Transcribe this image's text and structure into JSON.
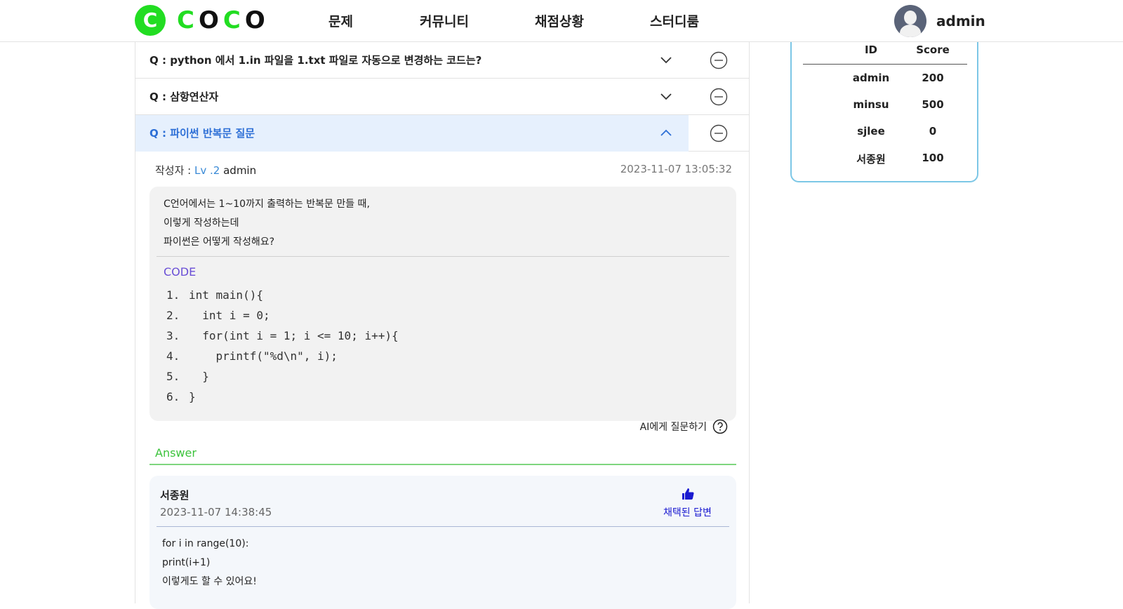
{
  "header": {
    "logo_letter": "C",
    "logo_text_1": "C",
    "logo_text_2": "O",
    "logo_text_3": "C",
    "logo_text_4": "O",
    "nav": [
      "문제",
      "커뮤니티",
      "채점상황",
      "스터디룸"
    ],
    "user_name": "admin"
  },
  "questions": [
    {
      "label": "Q : python 에서 1.in 파일을 1.txt 파일로 자동으로 변경하는 코드는?",
      "expanded": false
    },
    {
      "label": "Q : 삼항연산자",
      "expanded": false
    },
    {
      "label": "Q : 파이썬 반복문 질문",
      "expanded": true
    }
  ],
  "post": {
    "author_label": "작성자 : ",
    "level": "Lv .2",
    "author": "admin",
    "date": "2023-11-07 13:05:32",
    "body_lines": [
      "C언어에서는 1~10까지 출력하는 반복문 만들 때,",
      "이렇게 작성하는데",
      "파이썬은 어떻게 작성해요?"
    ],
    "code_label": "CODE",
    "code_lines": [
      {
        "num": "1.",
        "text": "int main(){"
      },
      {
        "num": "2.",
        "text": "  int i = 0;"
      },
      {
        "num": "3.",
        "text": "  for(int i = 1; i <= 10; i++){"
      },
      {
        "num": "4.",
        "text": "    printf(\"%d\\n\", i);"
      },
      {
        "num": "5.",
        "text": "  }"
      },
      {
        "num": "6.",
        "text": "}"
      }
    ],
    "ask_ai": "AI에게 질문하기"
  },
  "answer_section": {
    "title": "Answer",
    "answer": {
      "author": "서종원",
      "date": "2023-11-07 14:38:45",
      "accepted_label": "채택된 답변",
      "body_lines": [
        "for i in range(10):",
        "print(i+1)",
        "이렇게도 할 수 있어요!"
      ]
    }
  },
  "ranking": {
    "headers": {
      "id": "ID",
      "score": "Score"
    },
    "rows": [
      {
        "id": "admin",
        "score": "200"
      },
      {
        "id": "minsu",
        "score": "500"
      },
      {
        "id": "sjlee",
        "score": "0"
      },
      {
        "id": "서종원",
        "score": "100"
      }
    ]
  },
  "colors": {
    "brand_green": "#22dd22",
    "active_row_bg": "#e6f0fd",
    "active_text": "#2d6fd6",
    "code_label": "#6a4fd6",
    "answer_green": "#3cc33c",
    "accepted_blue": "#1a1ad0",
    "rank_border": "#7cc7e6"
  }
}
